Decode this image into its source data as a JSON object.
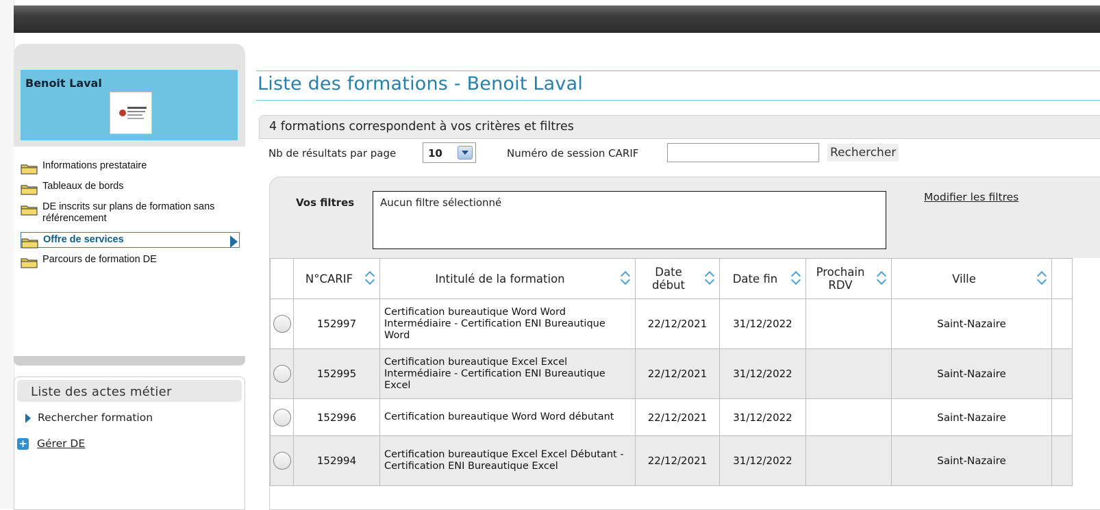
{
  "sidebar": {
    "profile_name": "Benoit Laval",
    "menu": [
      {
        "label": "Informations prestataire"
      },
      {
        "label": "Tableaux de bords"
      },
      {
        "label": "DE inscrits sur plans de formation sans référencement"
      },
      {
        "label": "Offre de services",
        "active": true
      },
      {
        "label": "Parcours de formation DE"
      }
    ],
    "actes_title": "Liste des actes métier",
    "actes": [
      {
        "label": "Rechercher formation"
      },
      {
        "label": "Gérer DE"
      }
    ]
  },
  "main": {
    "page_title": "Liste des formations - Benoit Laval",
    "count_text": "4 formations correspondent à vos critères et filtres",
    "results_per_page_label": "Nb de résultats par page",
    "results_per_page_value": "10",
    "session_label": "Numéro de session CARIF",
    "session_value": "",
    "search_button": "Rechercher",
    "filters_label": "Vos filtres",
    "filters_text": "Aucun filtre sélectionné",
    "modify_filters": "Modifier les filtres"
  },
  "table": {
    "columns": [
      "N°CARIF",
      "Intitulé de la formation",
      "Date début",
      "Date fin",
      "Prochain RDV",
      "Ville"
    ],
    "rows": [
      {
        "carif": "152997",
        "title": "Certification bureautique Word Word Intermédiaire - Certification ENI Bureautique Word",
        "start": "22/12/2021",
        "end": "31/12/2022",
        "rdv": "",
        "city": "Saint-Nazaire"
      },
      {
        "carif": "152995",
        "title": "Certification bureautique Excel Excel Intermédiaire - Certification ENI Bureautique Excel",
        "start": "22/12/2021",
        "end": "31/12/2022",
        "rdv": "",
        "city": "Saint-Nazaire"
      },
      {
        "carif": "152996",
        "title": "Certification bureautique Word Word débutant",
        "start": "22/12/2021",
        "end": "31/12/2022",
        "rdv": "",
        "city": "Saint-Nazaire"
      },
      {
        "carif": "152994",
        "title": "Certification bureautique Excel Excel Débutant - Certification ENI Bureautique Excel",
        "start": "22/12/2021",
        "end": "31/12/2022",
        "rdv": "",
        "city": "Saint-Nazaire"
      }
    ]
  },
  "colors": {
    "accent": "#2680ad",
    "profile_bg": "#6ec3e3",
    "topbar": "#2b2b2b",
    "row_alt": "#ebebeb"
  }
}
